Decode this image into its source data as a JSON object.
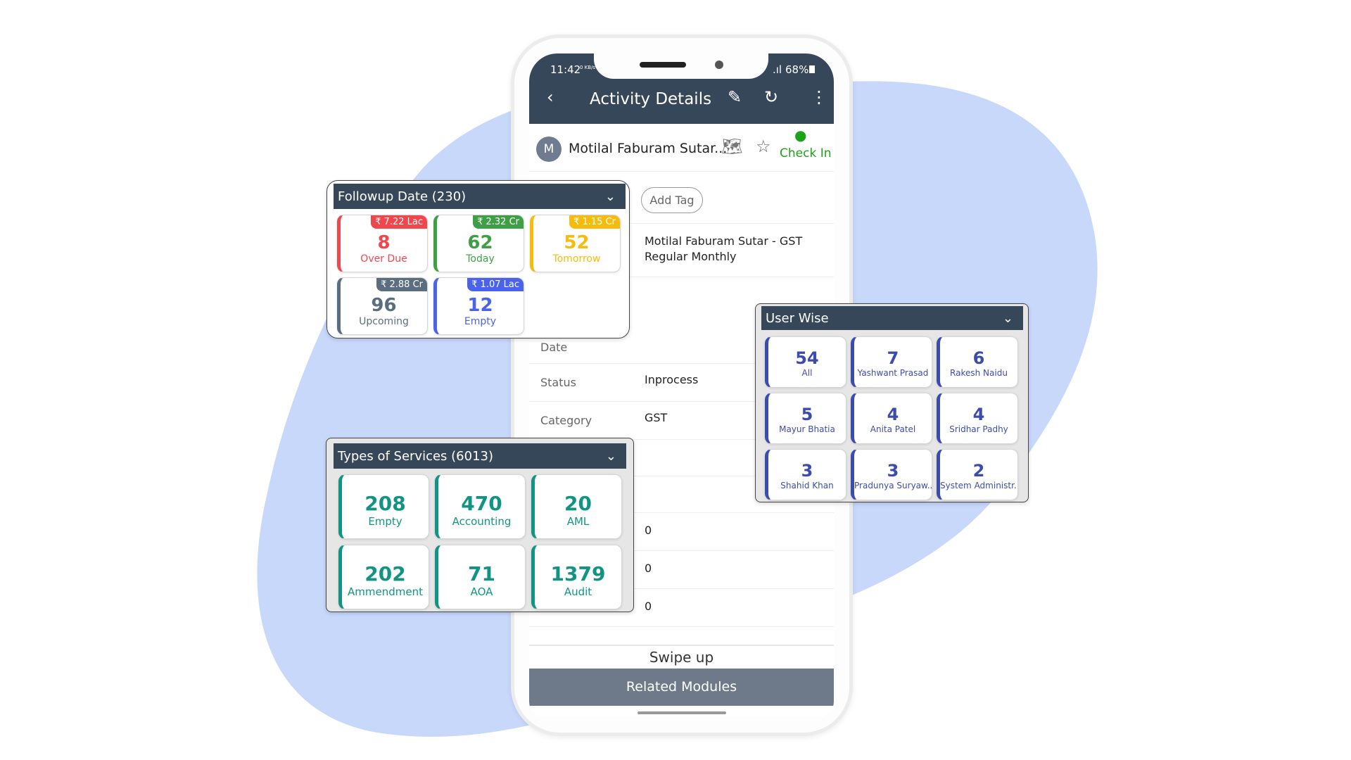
{
  "colors": {
    "blob": "#c8d8fb",
    "header": "#37475a",
    "overdue": "#f0474d",
    "today": "#3f9f47",
    "tomorrow": "#f5bc0d",
    "upcoming": "#5b6e80",
    "empty": "#4a63e8",
    "service": "#129485",
    "user": "#3b4cad",
    "checkin": "#1aa317"
  },
  "status_bar": {
    "time": "11:42",
    "net": "0 KB/s",
    "battery": "68%"
  },
  "header": {
    "title": "Activity Details",
    "back_icon": "chevron-left-icon",
    "edit_icon": "pencil-icon",
    "refresh_icon": "refresh-icon",
    "menu_icon": "more-vertical-icon"
  },
  "contact": {
    "avatar": "M",
    "name": "Motilal Faburam Sutar...",
    "check_in": "Check In"
  },
  "add_tag": "Add Tag",
  "details": {
    "subject": "Motilal Faburam Sutar - GST Regular Monthly",
    "date_label": "Date",
    "status_label": "Status",
    "status_value": "Inprocess",
    "category_label": "Category",
    "category_value": "GST",
    "zeros": [
      "0",
      "0",
      "0"
    ]
  },
  "swipe_up": "Swipe up",
  "related_modules": "Related Modules",
  "followup": {
    "title": "Followup Date (230)",
    "cards": [
      {
        "amount": "₹ 7.22 Lac",
        "count": "8",
        "label": "Over Due"
      },
      {
        "amount": "₹ 2.32 Cr",
        "count": "62",
        "label": "Today"
      },
      {
        "amount": "₹ 1.15 Cr",
        "count": "52",
        "label": "Tomorrow"
      },
      {
        "amount": "₹ 2.88 Cr",
        "count": "96",
        "label": "Upcoming"
      },
      {
        "amount": "₹ 1.07 Lac",
        "count": "12",
        "label": "Empty"
      }
    ]
  },
  "services": {
    "title": "Types of Services (6013)",
    "cards": [
      {
        "count": "208",
        "label": "Empty"
      },
      {
        "count": "470",
        "label": "Accounting"
      },
      {
        "count": "20",
        "label": "AML"
      },
      {
        "count": "202",
        "label": "Ammendment"
      },
      {
        "count": "71",
        "label": "AOA"
      },
      {
        "count": "1379",
        "label": "Audit"
      }
    ]
  },
  "users": {
    "title": "User Wise",
    "cards": [
      {
        "count": "54",
        "label": "All"
      },
      {
        "count": "7",
        "label": "Yashwant Prasad"
      },
      {
        "count": "6",
        "label": "Rakesh Naidu"
      },
      {
        "count": "5",
        "label": "Mayur Bhatia"
      },
      {
        "count": "4",
        "label": "Anita Patel"
      },
      {
        "count": "4",
        "label": "Sridhar Padhy"
      },
      {
        "count": "3",
        "label": "Shahid Khan"
      },
      {
        "count": "3",
        "label": "Pradunya Suryaw..."
      },
      {
        "count": "2",
        "label": "System Administr..."
      }
    ]
  }
}
